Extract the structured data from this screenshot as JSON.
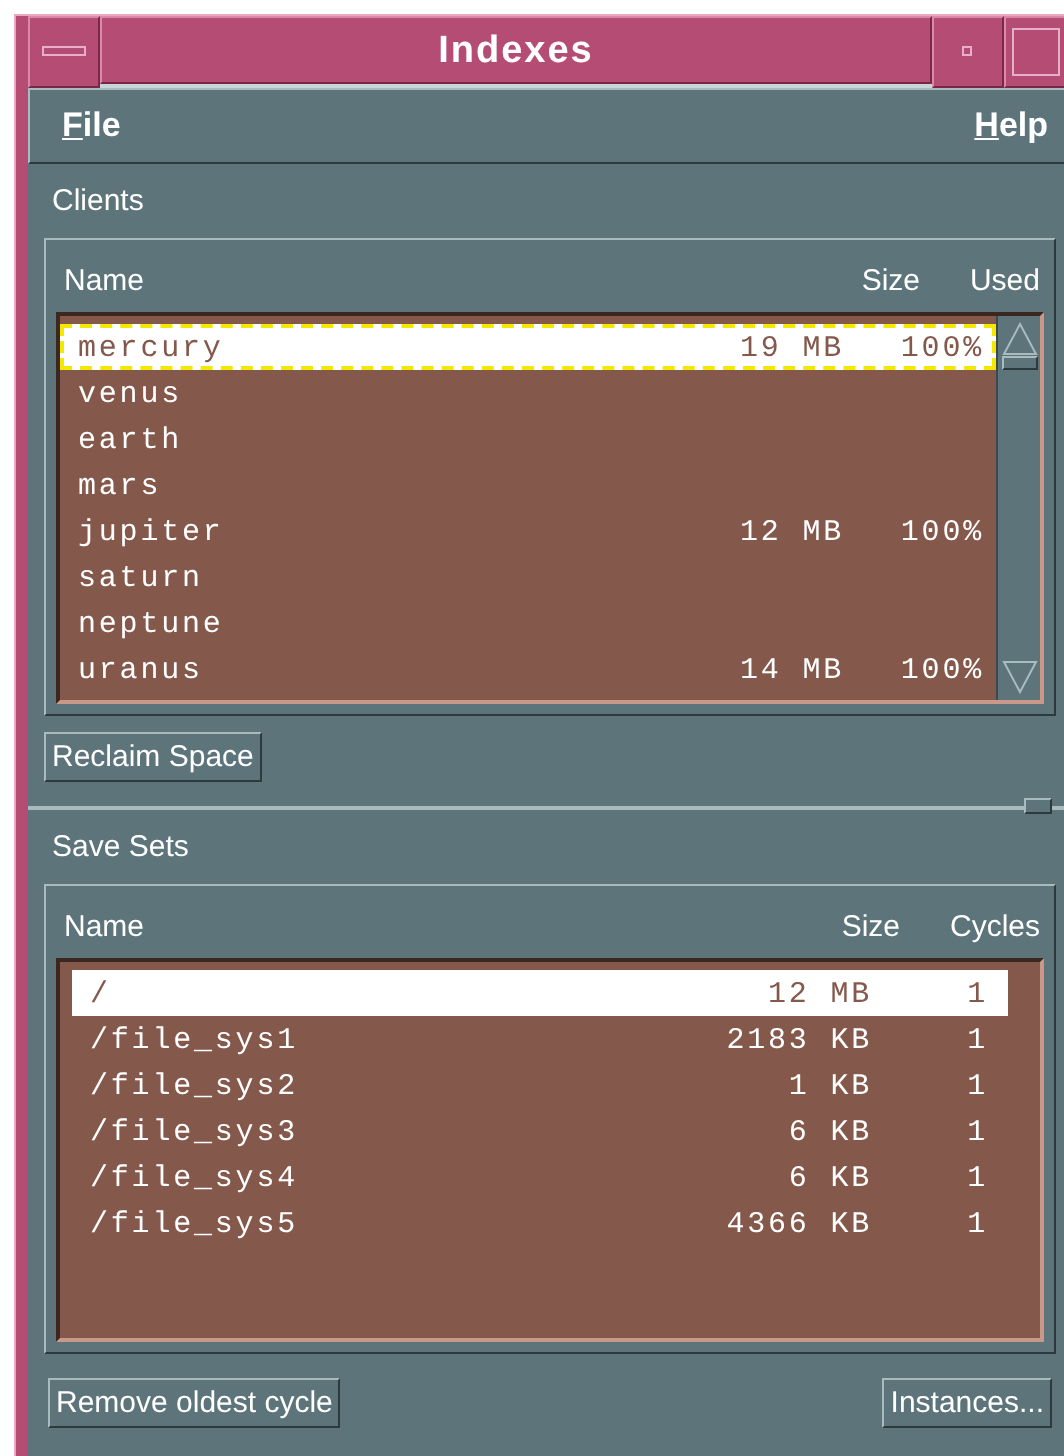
{
  "window": {
    "title": "Indexes"
  },
  "menu": [
    "File",
    "Help"
  ],
  "clients": {
    "label": "Clients",
    "columns": [
      "Name",
      "Size",
      "Used"
    ],
    "rows": [
      {
        "name": "mercury",
        "size": "19 MB",
        "used": "100%",
        "selected": true,
        "focused": true
      },
      {
        "name": "venus",
        "size": "",
        "used": "",
        "selected": false,
        "focused": false
      },
      {
        "name": "earth",
        "size": "",
        "used": "",
        "selected": false,
        "focused": false
      },
      {
        "name": "mars",
        "size": "",
        "used": "",
        "selected": false,
        "focused": false
      },
      {
        "name": "jupiter",
        "size": "12 MB",
        "used": "100%",
        "selected": false,
        "focused": false
      },
      {
        "name": "saturn",
        "size": "",
        "used": "",
        "selected": false,
        "focused": false
      },
      {
        "name": "neptune",
        "size": "",
        "used": "",
        "selected": false,
        "focused": false
      },
      {
        "name": "uranus",
        "size": "14 MB",
        "used": "100%",
        "selected": false,
        "focused": false
      }
    ],
    "button": "Reclaim Space"
  },
  "save_sets": {
    "label": "Save Sets",
    "columns": [
      "Name",
      "Size",
      "Cycles"
    ],
    "rows": [
      {
        "name": "/",
        "size": "12 MB",
        "cycles": "1",
        "selected": true
      },
      {
        "name": "/file_sys1",
        "size": "2183 KB",
        "cycles": "1",
        "selected": false
      },
      {
        "name": "/file_sys2",
        "size": "1 KB",
        "cycles": "1",
        "selected": false
      },
      {
        "name": "/file_sys3",
        "size": "6 KB",
        "cycles": "1",
        "selected": false
      },
      {
        "name": "/file_sys4",
        "size": "6 KB",
        "cycles": "1",
        "selected": false
      },
      {
        "name": "/file_sys5",
        "size": "4366 KB",
        "cycles": "1",
        "selected": false
      }
    ]
  },
  "buttons": [
    "Remove oldest cycle",
    "Instances..."
  ]
}
